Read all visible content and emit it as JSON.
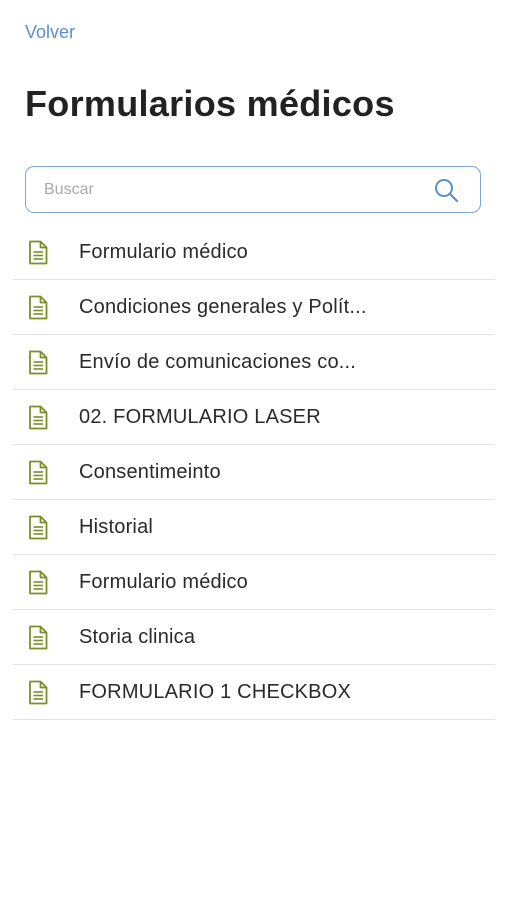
{
  "header": {
    "back_label": "Volver",
    "title": "Formularios médicos"
  },
  "search": {
    "placeholder": "Buscar",
    "value": ""
  },
  "colors": {
    "accent": "#5b8fcf",
    "icon_green": "#7a8f2a",
    "divider": "#e3e3e3"
  },
  "icons": {
    "search": "search-icon",
    "document": "document-icon"
  },
  "forms": [
    {
      "label": "Formulario médico"
    },
    {
      "label": "Condiciones generales y Polít..."
    },
    {
      "label": "Envío de comunicaciones co..."
    },
    {
      "label": "02. FORMULARIO LASER"
    },
    {
      "label": "Consentimeinto"
    },
    {
      "label": "Historial"
    },
    {
      "label": "Formulario médico"
    },
    {
      "label": "Storia clinica"
    },
    {
      "label": "FORMULARIO 1 CHECKBOX"
    }
  ]
}
